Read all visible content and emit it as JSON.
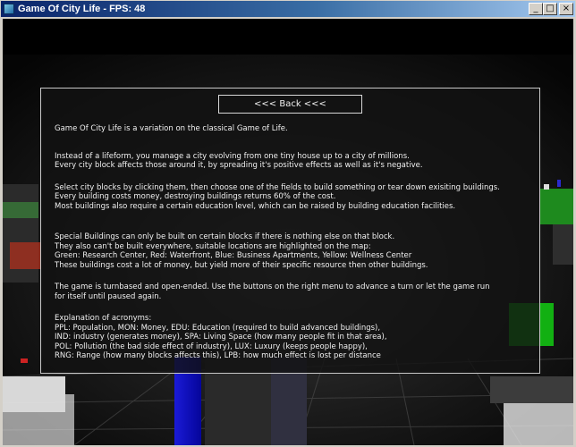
{
  "window": {
    "title": "Game Of City Life - FPS: 48",
    "icon": "app-icon",
    "controls": {
      "minimize": "_",
      "maximize": "□",
      "close": "×"
    }
  },
  "panel": {
    "back_button": "<<< Back <<<",
    "paragraphs": [
      {
        "lines": [
          "Game Of City Life is a variation on the classical Game of Life."
        ]
      },
      {
        "lines": [
          "Instead of a lifeform, you manage a city evolving from one tiny house up to a city of millions.",
          "Every city block affects those around it, by spreading it's positive effects as well as it's negative."
        ]
      },
      {
        "lines": [
          "Select city blocks by clicking them, then choose one of the fields to build something or tear down exisiting buildings.",
          "Every building costs money, destroying buildings returns 60% of the cost.",
          "Most buildings also require a certain education level, which can be raised by building education facilities."
        ]
      },
      {
        "lines": [
          "Special Buildings can only be built on certain blocks if there is nothing else on that block.",
          "They also can't be built everywhere, suitable locations are highlighted on the map:",
          "Green: Research Center, Red: Waterfront, Blue: Business Apartments, Yellow: Wellness Center",
          "These buildings cost a lot of money, but yield more of their specific resource then other buildings."
        ]
      },
      {
        "lines": [
          "The game is turnbased and open-ended. Use the buttons on the right menu to advance a turn or let the game run",
          "for itself until paused again."
        ]
      },
      {
        "lines": [
          "Explanation of acronyms:",
          "PPL: Population, MON: Money, EDU: Education (required to build advanced buildings),",
          "IND: industry (generates money), SPA: Living Space (how many people fit in that area),",
          "POL: Pollution (the bad side effect of industry), LUX: Luxury (keeps people happy),",
          "RNG: Range (how many blocks affects this), LPB: how much effect is lost per distance"
        ]
      }
    ]
  },
  "colors": {
    "titlebar_start": "#0a246a",
    "titlebar_end": "#a6caf0",
    "panel_border": "#c8c8c8",
    "text": "#f0f0f0"
  }
}
